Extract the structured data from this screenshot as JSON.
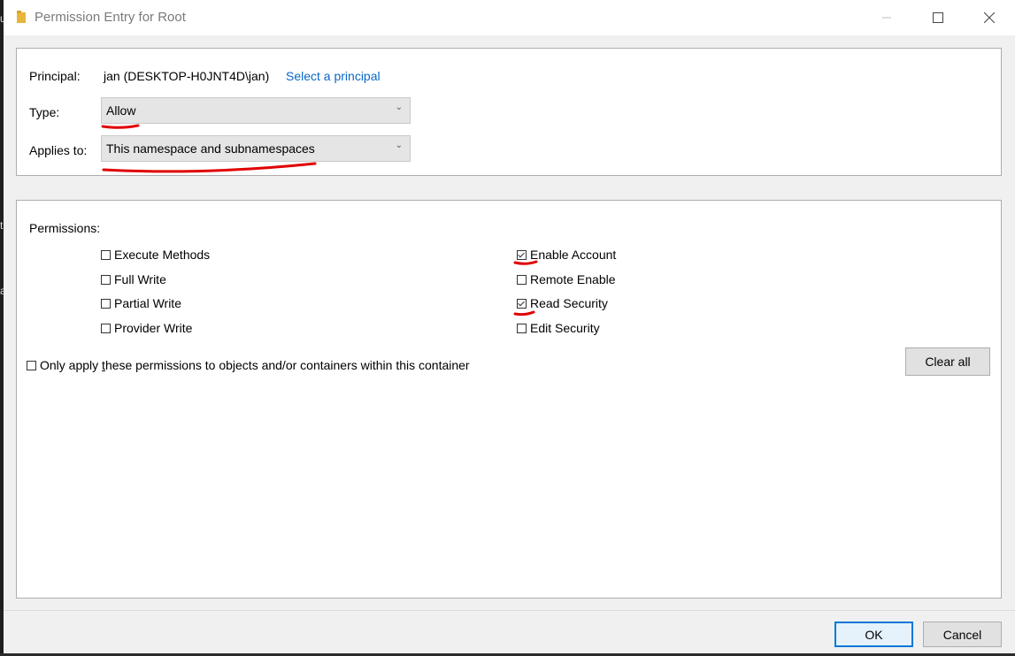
{
  "window": {
    "title": "Permission Entry for Root",
    "minimize_icon": "minimize-icon",
    "maximize_icon": "maximize-icon",
    "close_icon": "close-icon",
    "folder_icon": "folder-icon"
  },
  "left_edge_glyphs": [
    "u",
    "t",
    "a"
  ],
  "principal": {
    "label": "Principal:",
    "value": "jan (DESKTOP-H0JNT4D\\jan)",
    "link": "Select a principal"
  },
  "type": {
    "label": "Type:",
    "selected": "Allow"
  },
  "applies_to": {
    "label": "Applies to:",
    "selected": "This namespace and subnamespaces"
  },
  "permissions": {
    "label": "Permissions:",
    "left": [
      {
        "label": "Execute Methods",
        "checked": false
      },
      {
        "label": "Full Write",
        "checked": false
      },
      {
        "label": "Partial Write",
        "checked": false
      },
      {
        "label": "Provider Write",
        "checked": false
      }
    ],
    "right": [
      {
        "label": "Enable Account",
        "checked": true
      },
      {
        "label": "Remote Enable",
        "checked": false
      },
      {
        "label": "Read Security",
        "checked": true
      },
      {
        "label": "Edit Security",
        "checked": false
      }
    ]
  },
  "only_apply": {
    "pre": "Only apply ",
    "accel": "t",
    "post": "hese permissions to objects and/or containers within this container",
    "checked": false
  },
  "buttons": {
    "clear_all": "Clear all",
    "ok": "OK",
    "cancel": "Cancel"
  },
  "colors": {
    "link": "#0a68c7",
    "annotation_red": "#e00000",
    "ok_border": "#0078d7"
  }
}
